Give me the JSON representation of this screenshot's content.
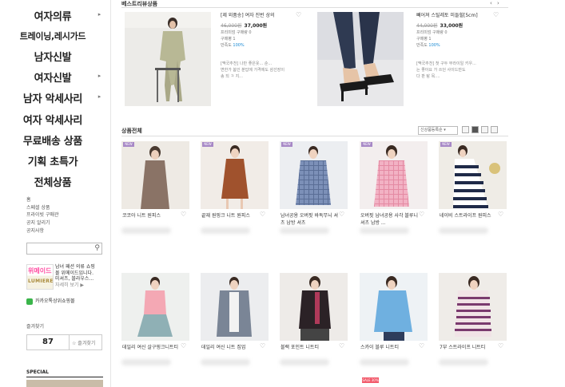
{
  "sidebar": {
    "categories": [
      {
        "label": "여자의류",
        "has_arrow": true
      },
      {
        "label": "트레이닝,레시가드",
        "has_arrow": false
      },
      {
        "label": "남자신발",
        "has_arrow": false
      },
      {
        "label": "여자신발",
        "has_arrow": true
      },
      {
        "label": "남자 악세사리",
        "has_arrow": true
      },
      {
        "label": "여자 악세사리",
        "has_arrow": false
      },
      {
        "label": "무료배송 상품",
        "has_arrow": false
      },
      {
        "label": "기획 초특가",
        "has_arrow": false
      },
      {
        "label": "전체상품",
        "has_arrow": false
      }
    ],
    "sublinks": [
      "홈",
      "스페셜 상품",
      "프라이빗 구매관",
      "공지 알리기",
      "공지사항"
    ],
    "ad": {
      "logo_text1": "위메이드",
      "logo_text2": "LUMIERE",
      "line1": "남녀 패션 의류 쇼핑",
      "line2": "몰 위메이드입니다.",
      "line3": "미셔츠, 블라우스...",
      "more": "자세히 보기 ▶"
    },
    "kakao_label": "카카오톡상위쇼핑몰",
    "fav_label": "즐겨찾기",
    "fav_count": "87",
    "fav_add": "즐겨찾기",
    "special_label": "SPECIAL"
  },
  "best": {
    "title": "베스트리뷰상품",
    "items": [
      {
        "name": "[제 외품송] 여자 진번 상의",
        "price_old": "46,000원",
        "price_new": "37,000원",
        "meta1": "프리미엄 구매량 0",
        "meta2": "구매평 1",
        "meta3_prefix": "만족도 ",
        "meta3_value": "100%",
        "review_title": "[맥국추천]",
        "review1": "나만 좋은옷... 순...",
        "review2": "변한가 봄인 분답에 가격에도 삼선장이",
        "review3": "송 되 ㅋ 지..."
      },
      {
        "name": "뻬어져 스틸레토 미들힐[5cm]",
        "price_old": "44,000원",
        "price_new": "33,000원",
        "meta1": "프리미엄 구매량 0",
        "meta2": "구매평 1",
        "meta3_prefix": "만족도 ",
        "meta3_value": "100%",
        "review_title": "[맥국추천]",
        "review1": "첫 구두 무라이일 키우...",
        "review2": "는 좋아요 가 쓰던 사이드만도",
        "review3": "다 판 탐 목...."
      }
    ]
  },
  "all_products": {
    "title": "상품전체",
    "sort_label": "신상품등록순",
    "items": [
      {
        "name": "코코아 니트 원피스"
      },
      {
        "name": "끝재 원핑크 니트 원피스"
      },
      {
        "name": "남녀공용 오버핏 바독무늬 셔츠 남방 셔츠"
      },
      {
        "name": "오버핏 남녀공용 사각 블루니 셔츠 남방 ..."
      },
      {
        "name": "네이비 스트라이프 원피스"
      },
      {
        "name": "데일리 여신 살구핑크니트티"
      },
      {
        "name": "데일리 여신 니트 집업"
      },
      {
        "name": "블랙 포인트 니트티"
      },
      {
        "name": "스카이 블루 니트티"
      },
      {
        "name": "7부 스트라이프 니트티"
      }
    ],
    "badge_text": "NEW",
    "sale_badge": "SALE 30%"
  }
}
